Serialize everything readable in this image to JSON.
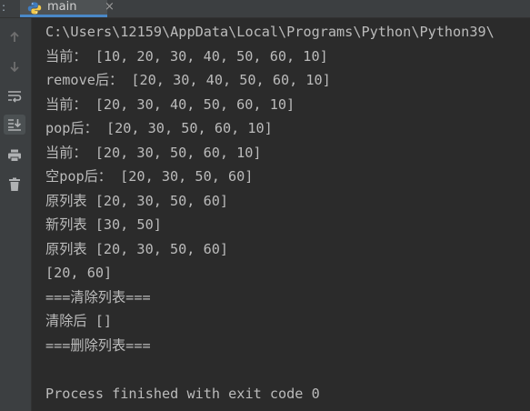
{
  "tab": {
    "label": "main",
    "close_glyph": "×",
    "icon": "python-icon"
  },
  "gutter": {
    "buttons": [
      "up-arrow-icon",
      "down-arrow-icon",
      "soft-wrap-icon",
      "scroll-to-end-icon",
      "print-icon",
      "trash-icon"
    ]
  },
  "console": {
    "lines": [
      "C:\\Users\\12159\\AppData\\Local\\Programs\\Python\\Python39\\",
      "当前： [10, 20, 30, 40, 50, 60, 10]",
      "remove后： [20, 30, 40, 50, 60, 10]",
      "当前： [20, 30, 40, 50, 60, 10]",
      "pop后： [20, 30, 50, 60, 10]",
      "当前： [20, 30, 50, 60, 10]",
      "空pop后： [20, 30, 50, 60]",
      "原列表 [20, 30, 50, 60]",
      "新列表 [30, 50]",
      "原列表 [20, 30, 50, 60]",
      "[20, 60]",
      "===清除列表===",
      "清除后 []",
      "===删除列表===",
      "",
      "Process finished with exit code 0"
    ]
  },
  "colors": {
    "background": "#2b2b2b",
    "panel": "#3c3f41",
    "text": "#bbbbbb",
    "tab_accent": "#4a88c7"
  }
}
